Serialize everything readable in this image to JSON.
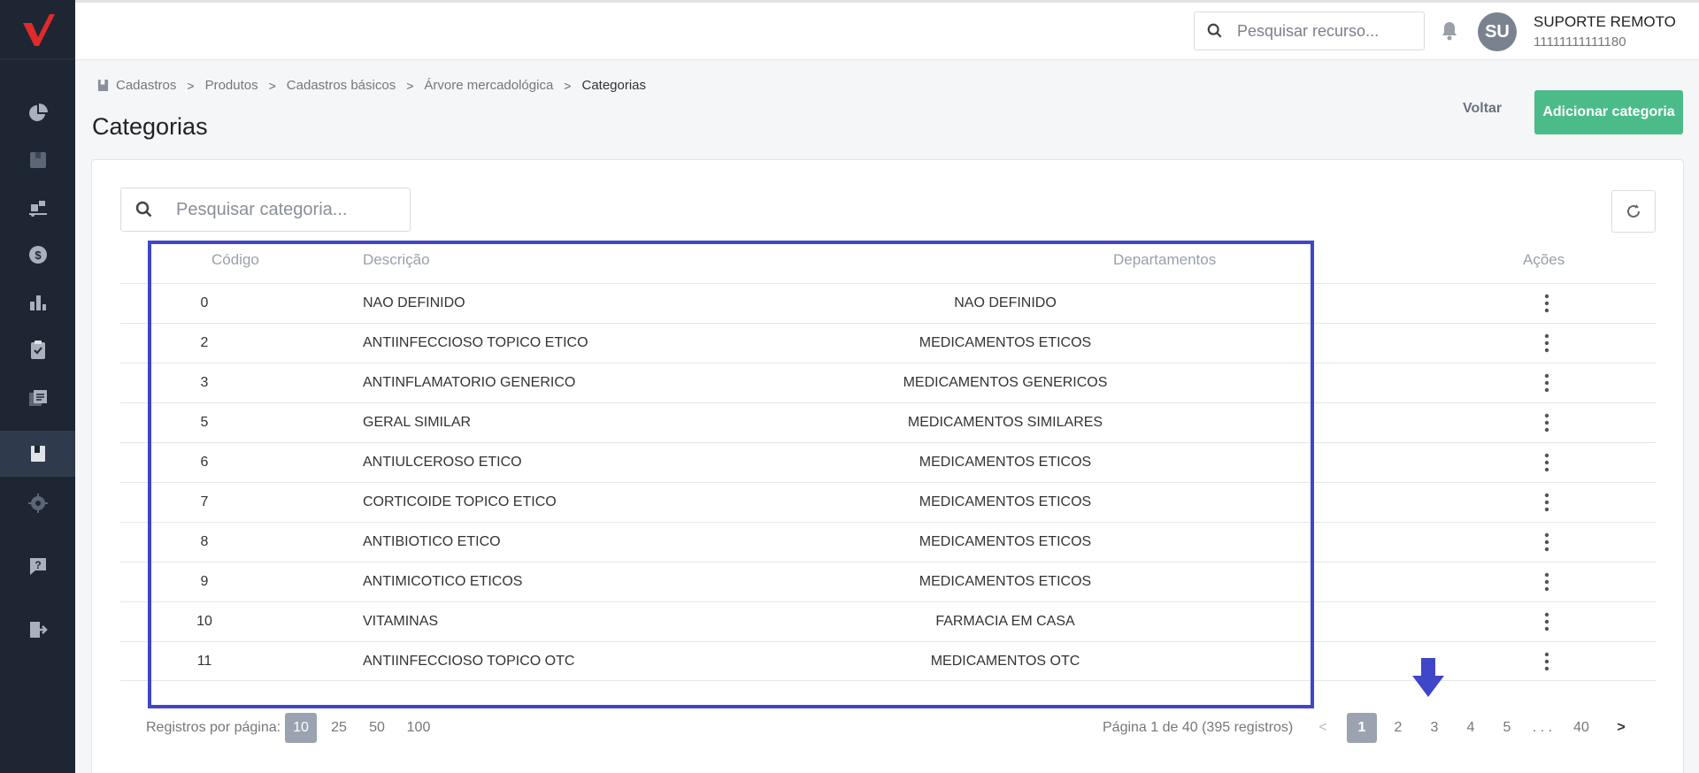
{
  "topbar": {
    "search_placeholder": "Pesquisar recurso...",
    "avatar_initials": "SU",
    "user_name": "SUPORTE REMOTO",
    "user_id": "11111111111180"
  },
  "sidebar": {
    "items": [
      {
        "icon": "dashboard-pie-icon"
      },
      {
        "icon": "box-icon"
      },
      {
        "icon": "logistics-icon"
      },
      {
        "icon": "dollar-icon"
      },
      {
        "icon": "bar-chart-icon"
      },
      {
        "icon": "clipboard-icon"
      },
      {
        "icon": "documents-icon"
      },
      {
        "icon": "book-icon",
        "active": true
      },
      {
        "icon": "gear-icon"
      },
      {
        "icon": "help-icon"
      },
      {
        "icon": "logout-icon"
      }
    ]
  },
  "breadcrumb": [
    "Cadastros",
    "Produtos",
    "Cadastros básicos",
    "Árvore mercadológica",
    "Categorias"
  ],
  "page": {
    "title": "Categorias",
    "back_label": "Voltar",
    "add_label": "Adicionar categoria"
  },
  "table": {
    "search_placeholder": "Pesquisar categoria...",
    "headers": {
      "code": "Código",
      "desc": "Descrição",
      "dept": "Departamentos",
      "actions": "Ações"
    },
    "rows": [
      {
        "code": "0",
        "desc": "NAO DEFINIDO",
        "dept": "NAO DEFINIDO"
      },
      {
        "code": "2",
        "desc": "ANTIINFECCIOSO TOPICO ETICO",
        "dept": "MEDICAMENTOS ETICOS"
      },
      {
        "code": "3",
        "desc": "ANTINFLAMATORIO GENERICO",
        "dept": "MEDICAMENTOS GENERICOS"
      },
      {
        "code": "5",
        "desc": "GERAL SIMILAR",
        "dept": "MEDICAMENTOS SIMILARES"
      },
      {
        "code": "6",
        "desc": "ANTIULCEROSO ETICO",
        "dept": "MEDICAMENTOS ETICOS"
      },
      {
        "code": "7",
        "desc": "CORTICOIDE TOPICO ETICO",
        "dept": "MEDICAMENTOS ETICOS"
      },
      {
        "code": "8",
        "desc": "ANTIBIOTICO ETICO",
        "dept": "MEDICAMENTOS ETICOS"
      },
      {
        "code": "9",
        "desc": "ANTIMICOTICO ETICOS",
        "dept": "MEDICAMENTOS ETICOS"
      },
      {
        "code": "10",
        "desc": "VITAMINAS",
        "dept": "FARMACIA EM CASA"
      },
      {
        "code": "11",
        "desc": "ANTIINFECCIOSO TOPICO OTC",
        "dept": "MEDICAMENTOS OTC"
      }
    ]
  },
  "pagination": {
    "per_page_label": "Registros por página:",
    "per_page_options": [
      "10",
      "25",
      "50",
      "100"
    ],
    "per_page_selected": "10",
    "info": "Página 1 de 40 (395 registros)",
    "pages": [
      "1",
      "2",
      "3",
      "4",
      "5",
      ". . .",
      "40"
    ],
    "current": "1"
  },
  "colors": {
    "sidebar_bg": "#1f2633",
    "accent_green": "#4cbb8a",
    "highlight_blue": "#3f46c8",
    "logo_red": "#e02b2b"
  }
}
